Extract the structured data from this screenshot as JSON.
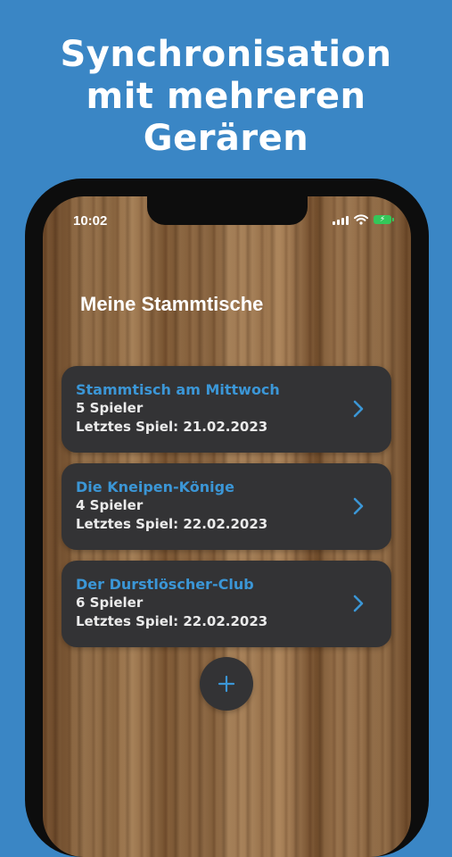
{
  "headline": {
    "line1": "Synchronisation",
    "line2": "mit mehreren",
    "line3": "Gerären"
  },
  "status_bar": {
    "time": "10:02",
    "icons": [
      "cellular-signal-icon",
      "wifi-icon",
      "battery-charging-icon"
    ]
  },
  "screen": {
    "title": "Meine Stammtische",
    "groups": [
      {
        "name": "Stammtisch am Mittwoch",
        "players": "5 Spieler",
        "last_game": "Letztes Spiel: 21.02.2023"
      },
      {
        "name": "Die Kneipen-Könige",
        "players": "4 Spieler",
        "last_game": "Letztes Spiel: 22.02.2023"
      },
      {
        "name": "Der Durstlöscher-Club",
        "players": "6 Spieler",
        "last_game": "Letztes Spiel: 22.02.2023"
      }
    ],
    "add_button_icon": "plus-icon"
  },
  "colors": {
    "background": "#3a86c5",
    "card": "#333335",
    "accent": "#3b96d6",
    "battery": "#34c759"
  }
}
